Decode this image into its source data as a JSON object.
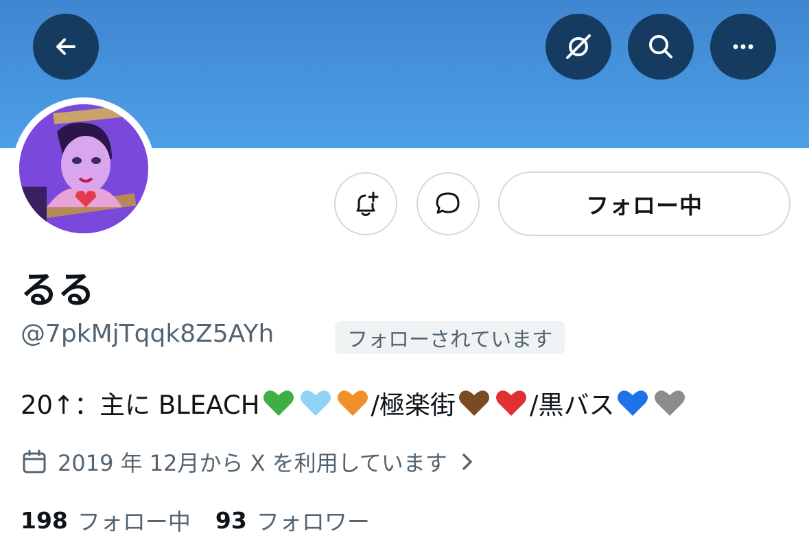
{
  "header": {
    "back_icon": "arrow-left-icon",
    "grok_icon": "grok-icon",
    "search_icon": "search-icon",
    "more_icon": "more-icon",
    "banner_color": "#4a96df"
  },
  "profile": {
    "display_name": "るる",
    "handle": "@7pkMjTqqk8Z5AYh",
    "follows_you": "フォローされています",
    "follow_button": "フォロー中",
    "bio": {
      "prefix": "20↑：主に BLEACH",
      "hearts_group_1": [
        "#3cb043",
        "#8fd3f5",
        "#f0902a"
      ],
      "mid_1": "/極楽街",
      "hearts_group_2": [
        "#7a4a23",
        "#e03131"
      ],
      "mid_2": "/黒バス",
      "hearts_group_3": [
        "#1f73e8",
        "#8c8c8c"
      ]
    },
    "joined": "2019 年 12月から X を利用しています",
    "following_count": "198",
    "following_label": "フォロー中",
    "followers_count": "93",
    "followers_label": "フォロワー"
  }
}
